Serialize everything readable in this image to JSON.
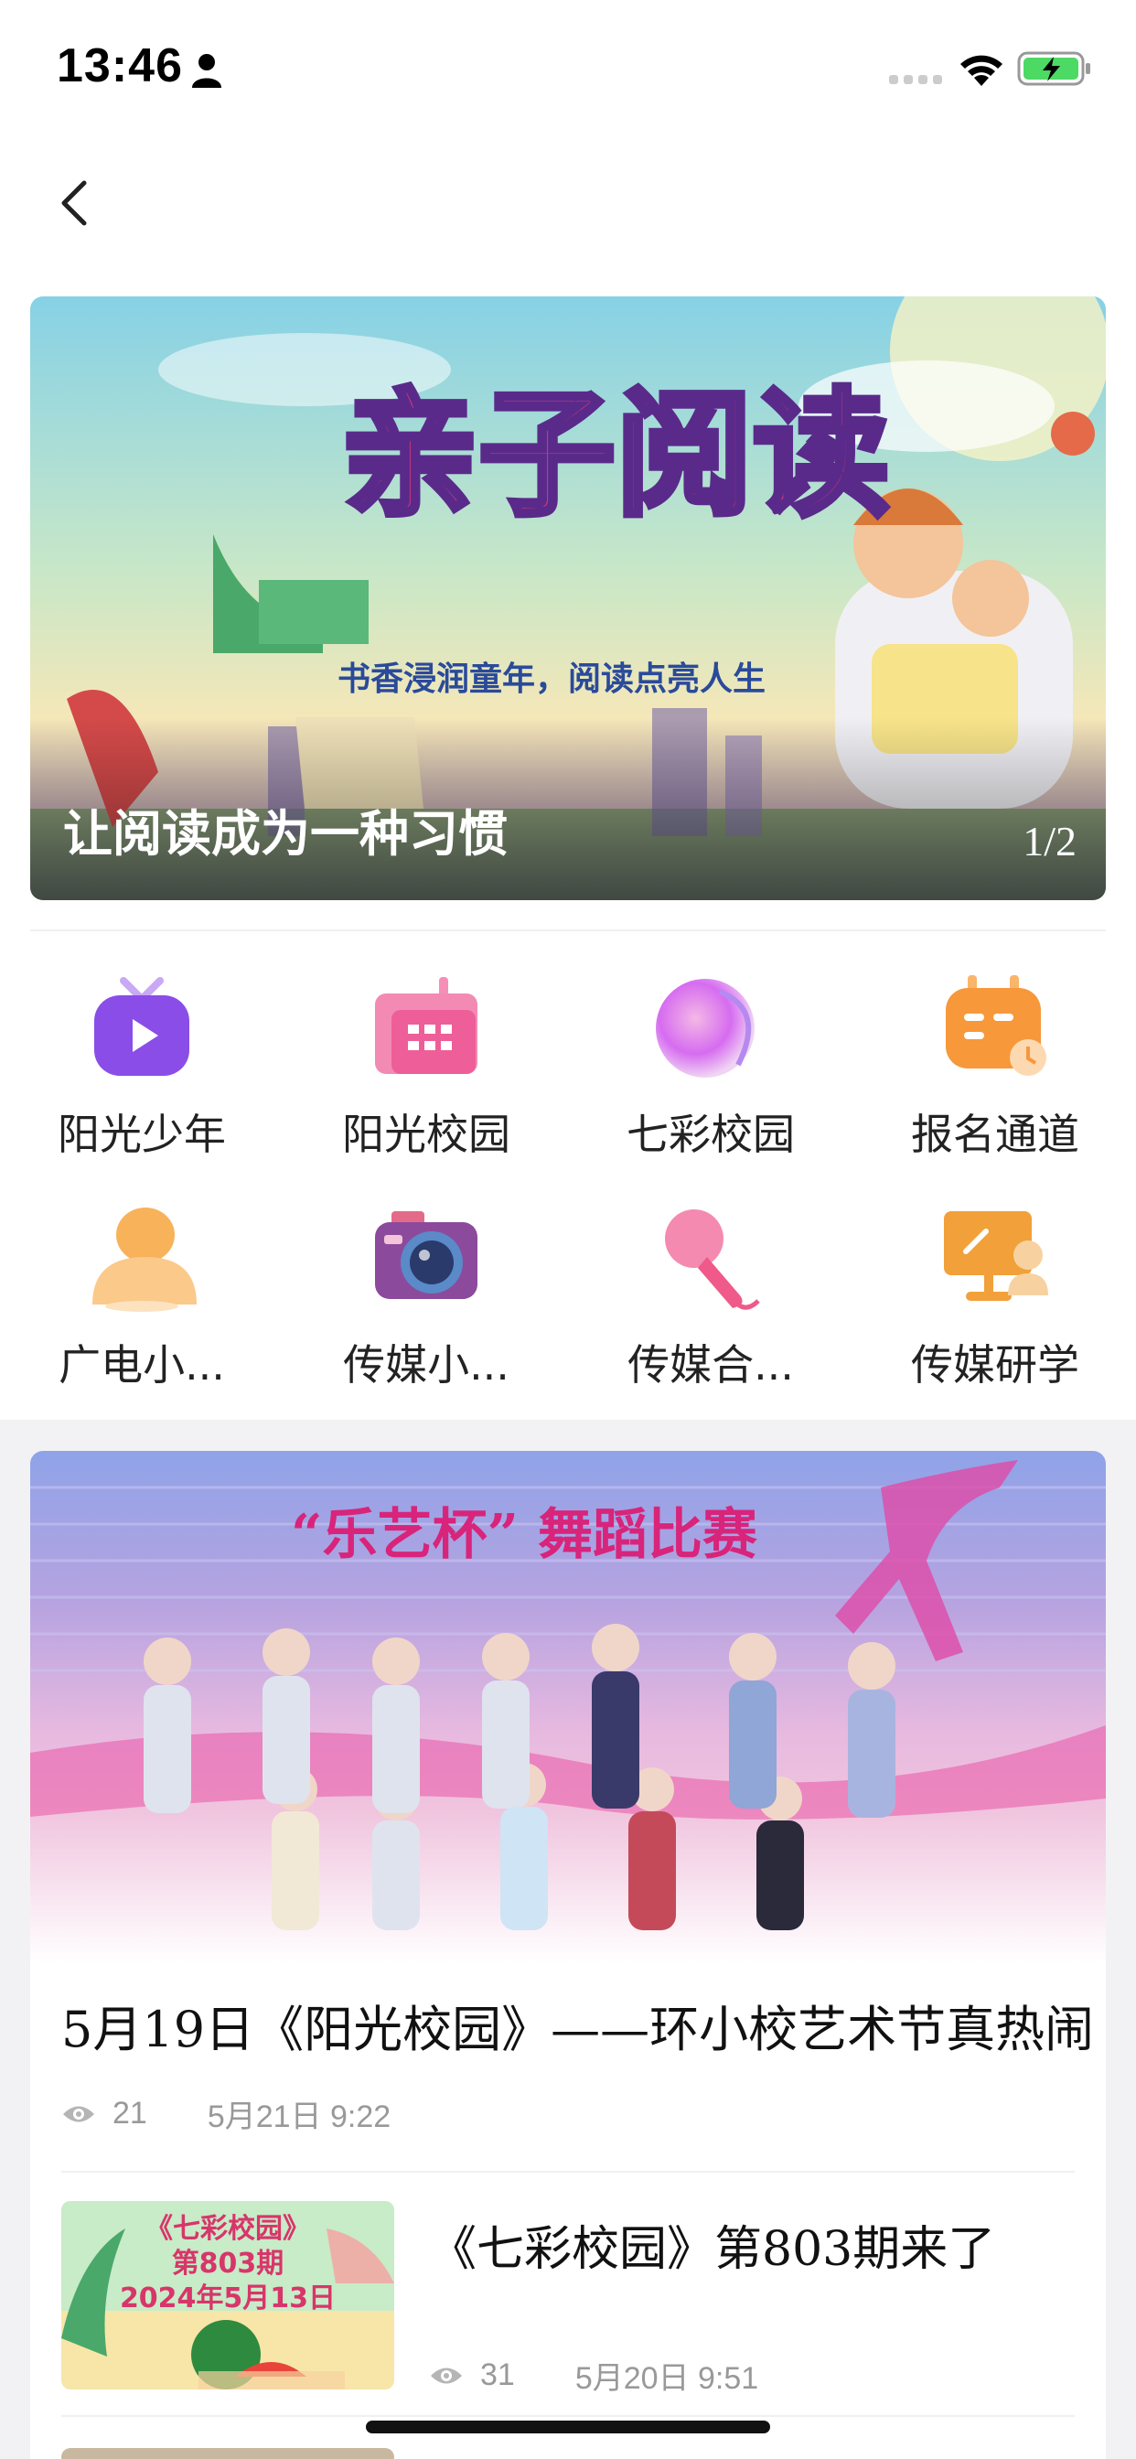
{
  "status_bar": {
    "time": "13:46"
  },
  "banner": {
    "headline_art": "亲子阅读",
    "slogan_art": "书香浸润童年，阅读点亮人生",
    "caption": "让阅读成为一种习惯",
    "counter": "1/2"
  },
  "grid": [
    {
      "label": "阳光少年",
      "icon": "play-tv-icon",
      "color": "#8a4de8"
    },
    {
      "label": "阳光校园",
      "icon": "calendar-grid-icon",
      "color": "#f06aa0"
    },
    {
      "label": "七彩校园",
      "icon": "gradient-orb-icon",
      "color": "#d66cf0"
    },
    {
      "label": "报名通道",
      "icon": "calendar-clock-icon",
      "color": "#f7983a"
    },
    {
      "label": "广电小...",
      "icon": "person-icon",
      "color": "#f7b25a"
    },
    {
      "label": "传媒小...",
      "icon": "camera-icon",
      "color": "#8c4a9c"
    },
    {
      "label": "传媒合...",
      "icon": "microphone-icon",
      "color": "#ef5a8a"
    },
    {
      "label": "传媒研学",
      "icon": "presentation-icon",
      "color": "#f2a03a"
    }
  ],
  "feed": {
    "featured": {
      "image_text": "“乐艺杯” 舞蹈比赛",
      "title": "5月19日《阳光校园》——环小校艺术节真热闹",
      "views": "21",
      "time": "5月21日  9:22"
    },
    "items": [
      {
        "thumb_lines": [
          "《七彩校园》",
          "第803期",
          "2024年5月13日"
        ],
        "title": "《七彩校园》第803期来了",
        "views": "31",
        "time": "5月20日  9:51"
      }
    ]
  }
}
